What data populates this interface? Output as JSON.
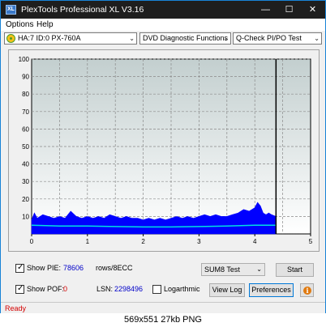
{
  "window": {
    "title": "PlexTools Professional XL V3.16",
    "app_icon_text": "XL",
    "minimize_glyph": "—",
    "maximize_glyph": "☐",
    "close_glyph": "✕"
  },
  "menu": {
    "options_label": "Options",
    "help_label": "Help"
  },
  "toolbar": {
    "drive": "HA:7 ID:0  PX-760A",
    "function": "DVD Diagnostic Functions",
    "test": "Q-Check PI/PO Test",
    "dropdown_glyph": "⌄"
  },
  "chart_data": {
    "type": "area",
    "xlim": [
      0,
      5
    ],
    "ylim": [
      0,
      100
    ],
    "x_ticks": [
      "0",
      "1",
      "2",
      "3",
      "4",
      "5"
    ],
    "y_ticks": [
      "10",
      "20",
      "30",
      "40",
      "50",
      "60",
      "70",
      "80",
      "90",
      "100"
    ],
    "grid": true,
    "end_marker_x": 4.38,
    "colors": {
      "plot_top": "#c3cfcf",
      "plot_bottom": "#ffffff",
      "bars": "#0000ff",
      "average_line": "#00e0e0",
      "grid": "#8a8a8a"
    },
    "series": [
      {
        "values": [
          [
            0,
            8
          ],
          [
            0.05,
            12
          ],
          [
            0.1,
            9
          ],
          [
            0.2,
            11
          ],
          [
            0.3,
            10
          ],
          [
            0.4,
            9
          ],
          [
            0.5,
            10
          ],
          [
            0.6,
            9
          ],
          [
            0.7,
            13
          ],
          [
            0.8,
            10
          ],
          [
            0.9,
            9
          ],
          [
            1.0,
            10
          ],
          [
            1.1,
            9
          ],
          [
            1.2,
            10
          ],
          [
            1.3,
            9
          ],
          [
            1.4,
            11
          ],
          [
            1.5,
            10
          ],
          [
            1.6,
            9
          ],
          [
            1.7,
            10
          ],
          [
            1.8,
            9
          ],
          [
            1.9,
            9
          ],
          [
            2.0,
            8
          ],
          [
            2.1,
            9
          ],
          [
            2.2,
            8
          ],
          [
            2.3,
            9
          ],
          [
            2.4,
            8
          ],
          [
            2.5,
            9
          ],
          [
            2.6,
            10
          ],
          [
            2.7,
            9
          ],
          [
            2.8,
            10
          ],
          [
            2.9,
            9
          ],
          [
            3.0,
            10
          ],
          [
            3.1,
            11
          ],
          [
            3.2,
            10
          ],
          [
            3.3,
            11
          ],
          [
            3.4,
            10
          ],
          [
            3.5,
            10
          ],
          [
            3.6,
            11
          ],
          [
            3.7,
            12
          ],
          [
            3.8,
            14
          ],
          [
            3.9,
            13
          ],
          [
            4.0,
            15
          ],
          [
            4.05,
            18
          ],
          [
            4.1,
            16
          ],
          [
            4.15,
            12
          ],
          [
            4.2,
            11
          ],
          [
            4.25,
            12
          ],
          [
            4.3,
            11
          ],
          [
            4.38,
            10
          ]
        ]
      },
      {
        "values": [
          [
            0,
            5
          ],
          [
            0.5,
            4.5
          ],
          [
            1.0,
            4.5
          ],
          [
            1.5,
            4.2
          ],
          [
            2.0,
            4
          ],
          [
            2.5,
            4
          ],
          [
            3.0,
            4.2
          ],
          [
            3.5,
            4.5
          ],
          [
            4.0,
            5
          ],
          [
            4.38,
            5
          ]
        ]
      }
    ]
  },
  "bottom": {
    "show_pie_label": "Show PIE:",
    "pie_value": "78606",
    "pie_unit": "rows/8ECC",
    "show_pof_label": "Show POF:",
    "pof_value": "0",
    "lsn_label": "LSN:",
    "lsn_value": "2298496",
    "logarithmic_label": "Logarthmic",
    "test_select": "SUM8 Test",
    "start_label": "Start",
    "view_log_label": "View Log",
    "preferences_label": "Preferences",
    "info_glyph": "i"
  },
  "status": {
    "text": "Ready"
  },
  "caption": "569x551  27kb  PNG"
}
